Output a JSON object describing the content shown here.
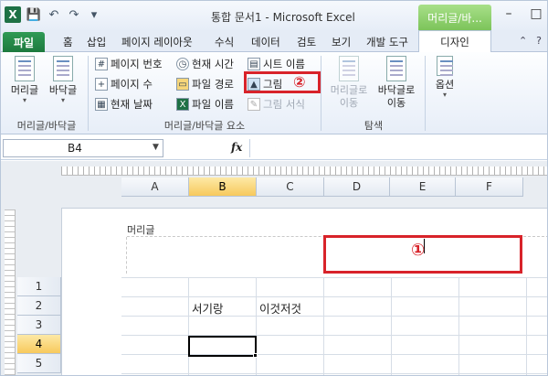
{
  "window": {
    "title": "통합 문서1 - Microsoft Excel",
    "context_tab": "머리글/바...",
    "logo": "X"
  },
  "tabs": {
    "file": "파일",
    "items": [
      "홈",
      "삽입",
      "페이지 레이아웃",
      "수식",
      "데이터",
      "검토",
      "보기",
      "개발 도구"
    ],
    "design": "디자인"
  },
  "ribbon": {
    "group1": {
      "label": "머리글/바닥글",
      "header_btn": "머리글",
      "footer_btn": "바닥글"
    },
    "group2": {
      "label": "머리글/바닥글 요소",
      "page_number": "페이지 번호",
      "page_count": "페이지 수",
      "current_date": "현재 날짜",
      "current_time": "현재 시간",
      "file_path": "파일 경로",
      "file_name": "파일 이름",
      "sheet_name": "시트 이름",
      "picture": "그림",
      "picture_format": "그림 서식"
    },
    "group3": {
      "label": "탐색",
      "goto_header": [
        "머리글로",
        "이동"
      ],
      "goto_footer": [
        "바닥글로",
        "이동"
      ]
    },
    "group4": {
      "options": "옵션"
    }
  },
  "annotations": {
    "one": "①",
    "two": "②"
  },
  "formula_bar": {
    "name_box": "B4",
    "fx": "fx"
  },
  "sheet": {
    "columns": [
      "A",
      "B",
      "C",
      "D",
      "E",
      "F"
    ],
    "selected_column": "B",
    "rows": [
      "1",
      "2",
      "3",
      "4",
      "5"
    ],
    "selected_row": "4",
    "header_label": "머리글",
    "cells": {
      "B2": "서기랑",
      "C2": "이것저것"
    }
  }
}
